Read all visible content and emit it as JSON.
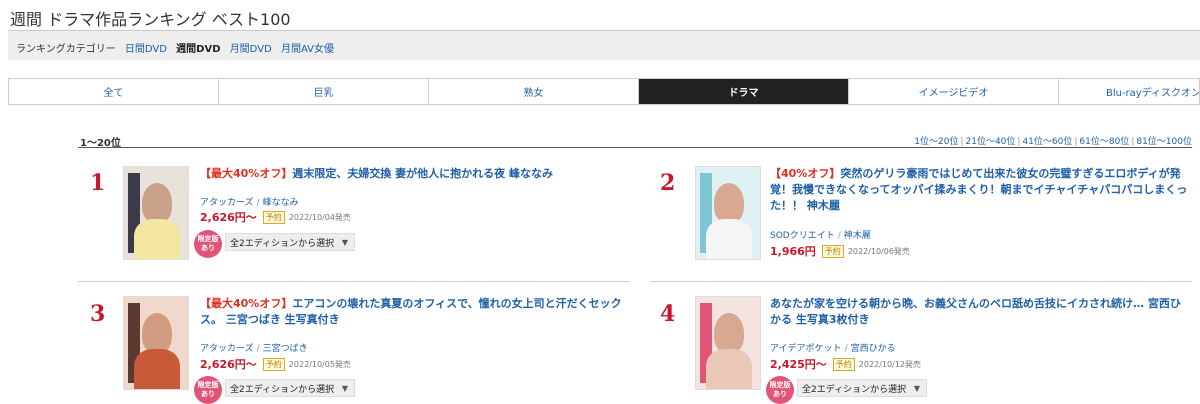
{
  "page": {
    "title": "週間 ドラマ作品ランキング ベスト100"
  },
  "category_bar": {
    "label": "ランキングカテゴリー",
    "items": [
      {
        "label": "日間DVD",
        "current": false
      },
      {
        "label": "週間DVD",
        "current": true
      },
      {
        "label": "月間DVD",
        "current": false
      },
      {
        "label": "月間AV女優",
        "current": false
      }
    ]
  },
  "tabs": [
    {
      "label": "全て",
      "active": false
    },
    {
      "label": "巨乳",
      "active": false
    },
    {
      "label": "熟女",
      "active": false
    },
    {
      "label": "ドラマ",
      "active": true
    },
    {
      "label": "イメージビデオ",
      "active": false
    },
    {
      "label": "Blu-rayディスクオンデマ",
      "active": false
    }
  ],
  "range": {
    "current": "1〜20位",
    "pages": [
      "1位〜20位",
      "21位〜40位",
      "41位〜60位",
      "61位〜80位",
      "81位〜100位"
    ]
  },
  "colors": {
    "link": "#1f5fa8",
    "promo": "#e0301e",
    "rank": "#c8162c",
    "price": "#c8162c",
    "limited_badge": "#e05577",
    "active_tab": "#222222"
  },
  "items": [
    {
      "rank": "1",
      "promo": "【最大40%オフ】",
      "title": "週末限定、夫婦交換 妻が他人に抱かれる夜 峰ななみ",
      "maker": "アタッカーズ",
      "actress": "峰ななみ",
      "price": "2,626円〜",
      "reserve": "予約",
      "release": "2022/10/04発売",
      "limited": "限定版あり",
      "edition_select": "全2エディションから選択",
      "caret_icon": "caret-down-icon"
    },
    {
      "rank": "2",
      "promo": "【40%オフ】",
      "title": "突然のゲリラ豪雨ではじめて出来た彼女の完璧すぎるエロボディが発覚！我慢できなくなってオッパイ揉みまくり！朝までイチャイチャパコパコしまくった！！ 神木麗",
      "maker": "SODクリエイト",
      "actress": "神木麗",
      "price": "1,966円",
      "reserve": "予約",
      "release": "2022/10/06発売"
    },
    {
      "rank": "3",
      "promo": "【最大40%オフ】",
      "title": "エアコンの壊れた真夏のオフィスで、憧れの女上司と汗だくセックス。 三宮つばき 生写真付き",
      "maker": "アタッカーズ",
      "actress": "三宮つばき",
      "price": "2,626円〜",
      "reserve": "予約",
      "release": "2022/10/05発売",
      "limited": "限定版あり",
      "edition_select": "全2エディションから選択",
      "caret_icon": "caret-down-icon"
    },
    {
      "rank": "4",
      "promo": "",
      "title": "あなたが家を空ける朝から晩、お義父さんのベロ舐め舌技にイカされ続け… 宮西ひかる 生写真3枚付き",
      "maker": "アイデアポケット",
      "actress": "宮西ひかる",
      "price": "2,425円〜",
      "reserve": "予約",
      "release": "2022/10/12発売",
      "limited": "限定版あり",
      "edition_select": "全2エディションから選択",
      "caret_icon": "caret-down-icon"
    }
  ]
}
